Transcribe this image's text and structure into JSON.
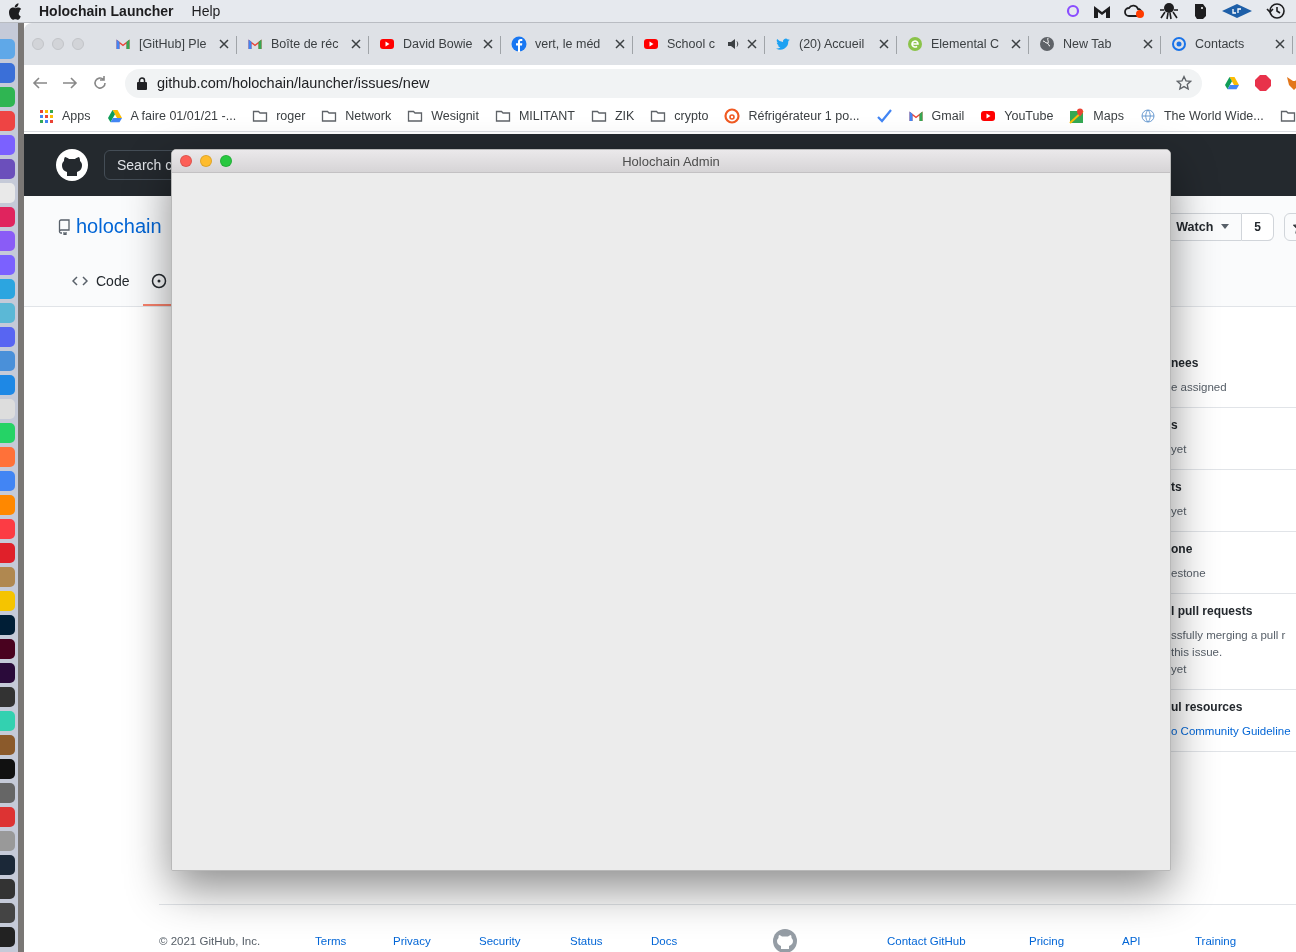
{
  "menu_bar": {
    "app_name": "Holochain Launcher",
    "menus": [
      "Help"
    ]
  },
  "browser": {
    "tabs": [
      {
        "title": "[GitHub] Ple",
        "kind": "gmail",
        "audio": false,
        "selected": false
      },
      {
        "title": "Boîte de réc",
        "kind": "gmail",
        "audio": false,
        "selected": false
      },
      {
        "title": "David Bowie",
        "kind": "youtube",
        "audio": false,
        "selected": false
      },
      {
        "title": "vert, le méd",
        "kind": "facebook",
        "audio": false,
        "selected": false
      },
      {
        "title": "School c",
        "kind": "youtube",
        "audio": true,
        "selected": false
      },
      {
        "title": "(20) Accueil",
        "kind": "twitter",
        "audio": false,
        "selected": false
      },
      {
        "title": "Elemental C",
        "kind": "elemental",
        "audio": false,
        "selected": false
      },
      {
        "title": "New Tab",
        "kind": "globe",
        "audio": false,
        "selected": false
      },
      {
        "title": "Contacts",
        "kind": "contacts",
        "audio": false,
        "selected": false
      }
    ],
    "address": "github.com/holochain/launcher/issues/new",
    "bookmarks": [
      {
        "label": "Apps",
        "kind": "apps"
      },
      {
        "label": "A faire 01/01/21 -...",
        "kind": "drive"
      },
      {
        "label": "roger",
        "kind": "folder"
      },
      {
        "label": "Network",
        "kind": "folder"
      },
      {
        "label": "Wesignit",
        "kind": "folder"
      },
      {
        "label": "MILITANT",
        "kind": "folder"
      },
      {
        "label": "ZIK",
        "kind": "folder"
      },
      {
        "label": "crypto",
        "kind": "folder"
      },
      {
        "label": "Réfrigérateur 1 po...",
        "kind": "ring"
      },
      {
        "kind": "check"
      },
      {
        "label": "Gmail",
        "kind": "gmail"
      },
      {
        "label": "YouTube",
        "kind": "youtube"
      },
      {
        "label": "Maps",
        "kind": "maps"
      },
      {
        "label": "The World Wide...",
        "kind": "www"
      },
      {
        "kind": "folder"
      }
    ]
  },
  "github": {
    "search": "Search c",
    "repo_owner": "holochain",
    "nav": [
      {
        "label": "Code",
        "kind": "code",
        "selected": false
      },
      {
        "kind": "issue",
        "selected": true
      }
    ],
    "watch": {
      "label": "Watch",
      "count": "5"
    },
    "sidebar": [
      {
        "heading": "nees",
        "lines": [
          "e assigned"
        ]
      },
      {
        "heading": "s",
        "lines": [
          "yet"
        ]
      },
      {
        "heading": "ts",
        "lines": [
          "yet"
        ]
      },
      {
        "heading": "one",
        "lines": [
          "estone"
        ]
      },
      {
        "heading": "l pull requests",
        "lines": [
          "ssfully merging a pull r",
          "this issue.",
          "yet"
        ]
      },
      {
        "heading": "ul resources",
        "links": [
          "o Community Guideline"
        ]
      }
    ],
    "footer": {
      "left": [
        "© 2021 GitHub, Inc.",
        "Terms",
        "Privacy",
        "Security",
        "Status",
        "Docs"
      ],
      "right": [
        "Contact GitHub",
        "Pricing",
        "API",
        "Training"
      ]
    }
  },
  "admin_window": {
    "title": "Holochain Admin"
  }
}
